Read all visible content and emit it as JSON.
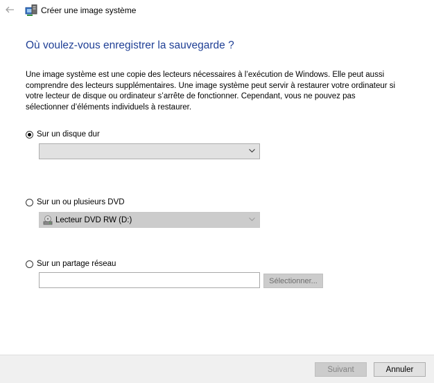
{
  "window": {
    "title": "Créer une image système"
  },
  "icons": {
    "back": "back-arrow-icon",
    "app": "system-image-icon",
    "drive": "dvd-drive-icon",
    "dropdown": "chevron-down-icon"
  },
  "heading": "Où voulez-vous enregistrer la sauvegarde ?",
  "description": "Une image système est une copie des lecteurs nécessaires à l’exécution de Windows. Elle peut aussi comprendre des lecteurs supplémentaires. Une image système peut servir à restaurer votre ordinateur si votre lecteur de disque ou ordinateur s’arrête de fonctionner. Cependant, vous ne pouvez pas sélectionner d’éléments individuels à restaurer.",
  "options": {
    "hard_disk": {
      "label": "Sur un disque dur",
      "selected": true,
      "value": ""
    },
    "dvd": {
      "label": "Sur un ou plusieurs DVD",
      "selected": false,
      "value": "Lecteur DVD RW (D:)"
    },
    "network": {
      "label": "Sur un partage réseau",
      "selected": false,
      "value": "",
      "browse_label": "Sélectionner..."
    }
  },
  "footer": {
    "next_label": "Suivant",
    "cancel_label": "Annuler"
  },
  "colors": {
    "heading": "#1f3f95",
    "footer_bg": "#f0f0f0",
    "disabled_bg": "#cccccc"
  }
}
